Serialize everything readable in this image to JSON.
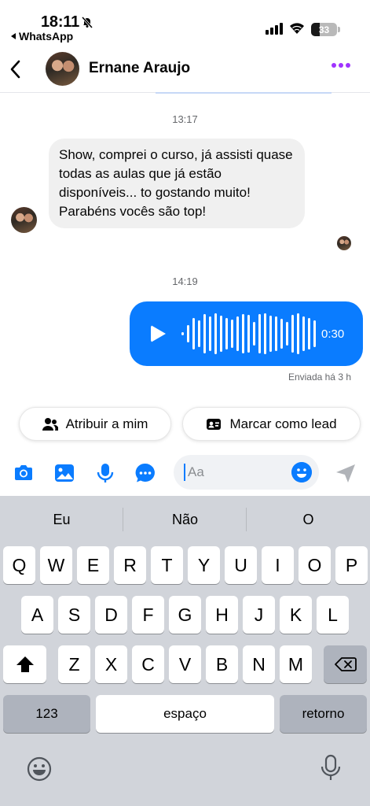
{
  "status_bar": {
    "time": "18:11",
    "back_app": "WhatsApp",
    "battery": "33",
    "battery_level": 0.33
  },
  "header": {
    "contact_name": "Ernane Araujo",
    "back_icon": "chevron-left-icon",
    "more_icon": "more-dots-icon",
    "accent_color": "#a033ff"
  },
  "messages": {
    "timestamp_1": "13:17",
    "incoming_text": "Show, comprei o curso, já assisti quase todas as aulas que já estão disponíveis... to gostando muito! Parabéns vocês são top!",
    "timestamp_2": "14:19",
    "audio_duration": "0:30",
    "sent_status": "Enviada há 3 h",
    "bubble_color": "#0a7cff"
  },
  "quick_actions": {
    "assign_label": "Atribuir a mim",
    "lead_label": "Marcar como lead"
  },
  "composer": {
    "placeholder": "Aa",
    "value": ""
  },
  "keyboard": {
    "suggestions": [
      "Eu",
      "Não",
      "O"
    ],
    "row1": [
      "Q",
      "W",
      "E",
      "R",
      "T",
      "Y",
      "U",
      "I",
      "O",
      "P"
    ],
    "row2": [
      "A",
      "S",
      "D",
      "F",
      "G",
      "H",
      "J",
      "K",
      "L"
    ],
    "row3": [
      "Z",
      "X",
      "C",
      "V",
      "B",
      "N",
      "M"
    ],
    "numbers_label": "123",
    "space_label": "espaço",
    "return_label": "retorno"
  }
}
